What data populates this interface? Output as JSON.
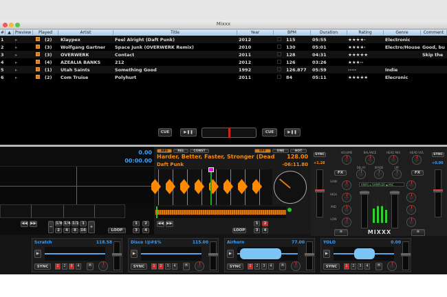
{
  "window": {
    "title": "Mixxx"
  },
  "library": {
    "columns": [
      "#",
      "Preview",
      "Played",
      "Artist",
      "Title",
      "Year",
      "BPM",
      "Duration",
      "Rating",
      "Genre",
      "Comment"
    ],
    "rows": [
      {
        "n": "1",
        "played": "(2)",
        "artist": "Klaypex",
        "title": "Feel Alright (Daft Punk)",
        "year": "2012",
        "bpm": "115",
        "duration": "05:55",
        "rating": "★★★★·",
        "genre": "Electronic",
        "comment": ""
      },
      {
        "n": "2",
        "played": "(3)",
        "artist": "Wolfgang Gartner",
        "title": "Space Junk (OVERWERK Remix)",
        "year": "2010",
        "bpm": "130",
        "duration": "05:01",
        "rating": "★★★★·",
        "genre": "Electro/House",
        "comment": "Good, bu"
      },
      {
        "n": "3",
        "played": "(3)",
        "artist": "OVERWERK",
        "title": "Contact",
        "year": "2011",
        "bpm": "128",
        "duration": "04:31",
        "rating": "★★★★★",
        "genre": "",
        "comment": "Skip the"
      },
      {
        "n": "4",
        "played": "(4)",
        "artist": "AZEALIA BANKS",
        "title": "212",
        "year": "2012",
        "bpm": "126",
        "duration": "03:26",
        "rating": "★★★··",
        "genre": "",
        "comment": ""
      },
      {
        "n": "5",
        "played": "(1)",
        "artist": "Utah Saints",
        "title": "Something Good",
        "year": "1992",
        "bpm": "126.877",
        "duration": "05:59",
        "rating": "·····",
        "genre": "Indie",
        "comment": ""
      },
      {
        "n": "6",
        "played": "(2)",
        "artist": "Com Truise",
        "title": "Polyhurt",
        "year": "2011",
        "bpm": "84",
        "duration": "05:11",
        "rating": "★★★★★",
        "genre": "Elecronic",
        "comment": ""
      }
    ]
  },
  "transport": {
    "cue": "CUE",
    "play": "▶❚❚"
  },
  "deck1": {
    "bpm": "0.00",
    "time": "00:00.00",
    "loop": "LOOP",
    "beatloops": [
      "1/8",
      "1/4",
      "1/2",
      "1",
      "2",
      "4",
      "8",
      "16"
    ]
  },
  "deck2": {
    "modes": [
      "ABS",
      "REL",
      "CONST"
    ],
    "cue_modes": [
      "OFF",
      "ONE",
      "HOT"
    ],
    "title": "Harder, Better, Faster, Stronger (Dead",
    "bpm": "128.00",
    "artist": "Daft Punk",
    "time": "-06:11.80",
    "loop": "LOOP",
    "hotcues": [
      "1",
      "2",
      "3",
      "4"
    ]
  },
  "mixer": {
    "sync": "SYNC",
    "pitch_left": "+1.28",
    "pitch_right": "+0.00",
    "knobs_top": [
      "VOLUME",
      "BALANCE",
      "HEAD MIX",
      "HEAD VOL"
    ],
    "knobs_mid": [
      "DELAY",
      "XFADE",
      "LPF"
    ],
    "fx": "FX",
    "eq": [
      "GAIN",
      "HIGH",
      "MID",
      "LOW"
    ],
    "chips": [
      "VINYL",
      "SAMPLER",
      "MIC"
    ],
    "logo": "MIXXX"
  },
  "samplers": [
    {
      "name": "Scratch",
      "bpm": "118.58"
    },
    {
      "name": "Disco !@#$%",
      "bpm": "115.00"
    },
    {
      "name": "Airhorn",
      "bpm": "77.00"
    },
    {
      "name": "YOLO",
      "bpm": "0.00"
    }
  ],
  "sampler_labels": {
    "sync": "SYNC",
    "hotcues": [
      "1",
      "2",
      "3",
      "4"
    ]
  },
  "colors": {
    "accent": "#ff8a00",
    "blue": "#3aa0ff",
    "hotcue": "#dd2222"
  }
}
